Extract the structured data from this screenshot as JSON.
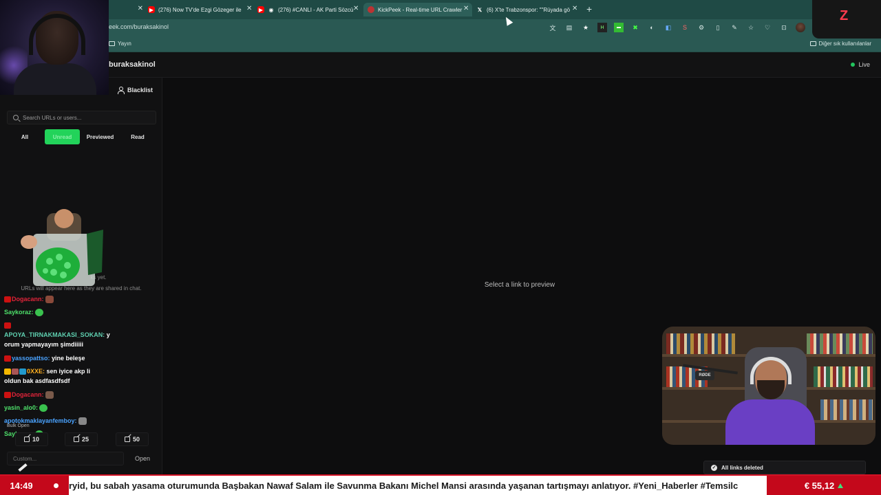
{
  "tabs": [
    {
      "title": "(276) Now TV'de Ezgi Gözeger ile",
      "icon": "youtube-icon"
    },
    {
      "title": "(276) #CANLI - AK Parti Sözcü",
      "icon": "youtube-icon"
    },
    {
      "title": "KickPeek - Real-time URL Crawler",
      "icon": "kickpeek-icon",
      "active": true
    },
    {
      "title": "(6) X'te Trabzonspor: \"\"Rüyada gö",
      "icon": "x-icon"
    }
  ],
  "address": {
    "url": "eek.com/buraksakinol"
  },
  "bookmarks": {
    "left": "Yayın",
    "right": "Diğer sık kullanılanlar"
  },
  "app": {
    "channel": "buraksakinol",
    "live_label": "Live",
    "blacklist_label": "Blacklist",
    "search_placeholder": "Search URLs or users...",
    "filters": [
      "All",
      "Unread",
      "Previewed",
      "Read"
    ],
    "active_filter": "Unread",
    "empty_title": "ks yet.",
    "empty_sub": "URLs will appear here as they are shared in chat.",
    "bulk_open_label": "Bulk Open",
    "bulk_buttons": [
      "10",
      "25",
      "50"
    ],
    "custom_placeholder": "Custom...",
    "open_label": "Open",
    "preview_message": "Select a link to preview",
    "toast": "All links deleted"
  },
  "chat": [
    {
      "user": "Dogacann:",
      "color": "#e0243a",
      "text": ""
    },
    {
      "user": "Saykoraz:",
      "color": "#4ee06a",
      "text": ""
    },
    {
      "user": "APOYA_TIRNAKMAKASI_SOKAN:",
      "color": "#5fd0b0",
      "text": " y"
    },
    {
      "user": "",
      "color": "#fff",
      "text": "orum yapmayayım şimdiiiii"
    },
    {
      "user": "yassopattso:",
      "color": "#4aa3ff",
      "text": " yine beleşe"
    },
    {
      "user": "0XXE:",
      "color": "#ffb020",
      "text": " sen iyice akp li"
    },
    {
      "user": "",
      "color": "#fff",
      "text": "oldun bak asdfasdfsdf"
    },
    {
      "user": "Dogacann:",
      "color": "#e0243a",
      "text": ""
    },
    {
      "user": "yasin_alo0:",
      "color": "#4ee06a",
      "text": ""
    },
    {
      "user": "apotokmaklayanfemboy:",
      "color": "#4aa3ff",
      "text": ""
    },
    {
      "user": "Saykoraz:",
      "color": "#4ee06a",
      "text": ""
    }
  ],
  "ticker": {
    "time": "14:49",
    "text": "ryid, bu sabah yasama oturumunda Başbakan Nawaf Salam ile Savunma Bakanı Michel Mansi arasında yaşanan tartışmayı anlatıyor. #Yeni_Haberler #Temsilc",
    "price": "€ 55,12"
  },
  "overlay": {
    "logo_letter": "Z",
    "mic_brand": "RØDE"
  },
  "colors": {
    "accent": "#22d35a",
    "ticker_red": "#c4081b",
    "browser_chrome": "#2a5953"
  }
}
